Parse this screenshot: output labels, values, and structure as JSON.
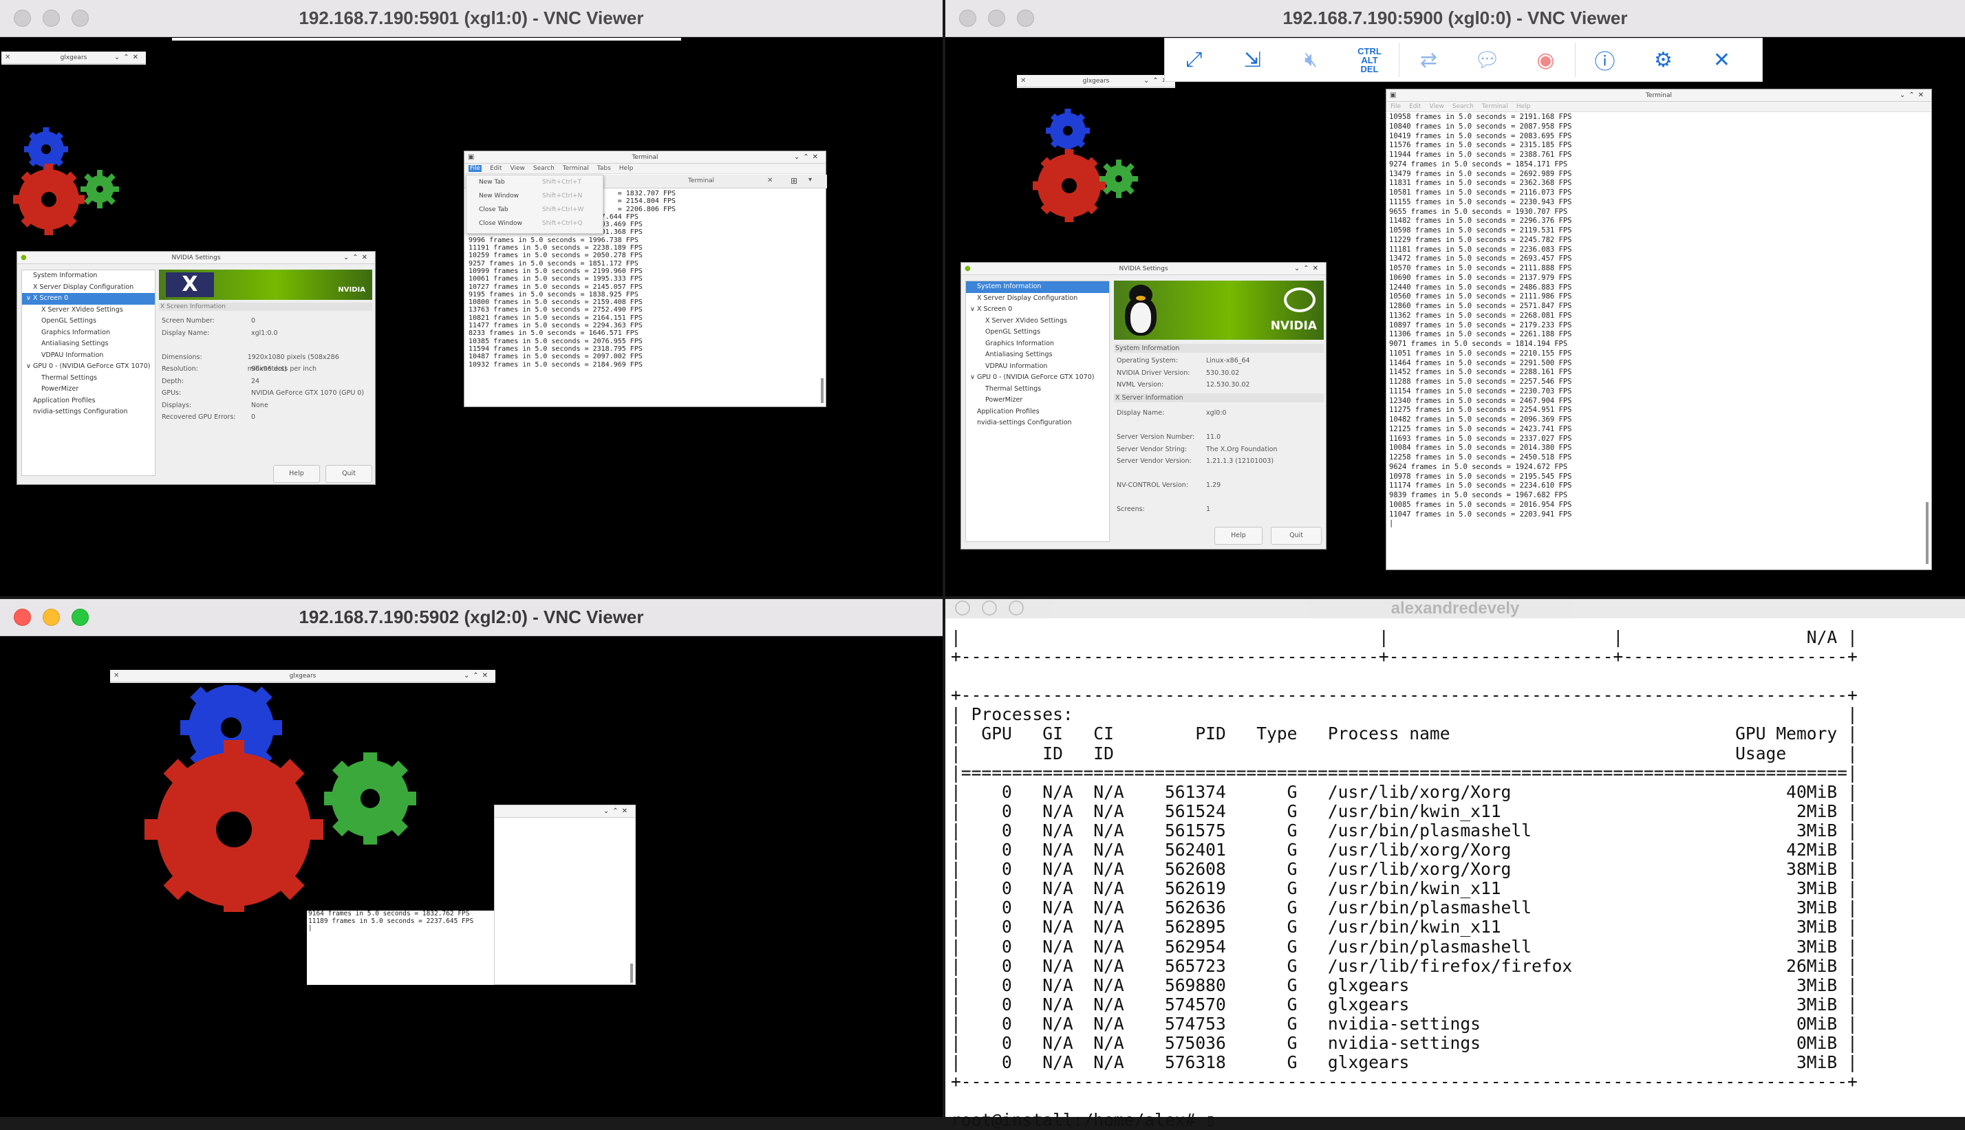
{
  "windows": {
    "tl": {
      "title": "192.168.7.190:5901 (xgl1:0) - VNC Viewer"
    },
    "tr": {
      "title": "192.168.7.190:5900 (xgl0:0) - VNC Viewer"
    },
    "bl": {
      "title": "192.168.7.190:5902 (xgl2:0) - VNC Viewer"
    },
    "br": {
      "title": "alexandredevely"
    }
  },
  "colors": {
    "gear_red": "#c8281c",
    "gear_green": "#3aa83a",
    "gear_blue": "#1f3fd6",
    "nvidia_green": "#76b900",
    "selection": "#3b84d8"
  },
  "toolbar": {
    "icons": [
      "fullscreen-icon",
      "scale-icon",
      "mute-icon",
      "ctrl-alt-del-icon",
      "transfer-icon",
      "chat-icon",
      "record-icon",
      "info-icon",
      "gear-icon",
      "close-icon"
    ],
    "ctrl_alt_del": "CTRL\nALT\nDEL"
  },
  "glxgears": {
    "title": "glxgears"
  },
  "terminal": {
    "title": "Terminal",
    "menu": [
      "File",
      "Edit",
      "View",
      "Search",
      "Terminal",
      "Tabs",
      "Help"
    ],
    "menu_tr": [
      "File",
      "Edit",
      "View",
      "Search",
      "Terminal",
      "Help"
    ],
    "file_menu": [
      "New Tab",
      "New Window",
      "Close Tab",
      "Close Window"
    ],
    "file_menu_keys": [
      "Shift+Ctrl+T",
      "Shift+Ctrl+N",
      "Shift+Ctrl+W",
      "Shift+Ctrl+Q"
    ],
    "tab_label": "Terminal",
    "tl_lines": "                                    = 1832.707 FPS\n                                    = 2154.804 FPS\n                                    = 2206.806 FPS\n9349 frames in 5.0 seconds = 1867.644 FPS\n11023 frames in 5.0 seconds = 2203.469 FPS\n11068 frames in 5.0 seconds = 2201.368 FPS\n9996 frames in 5.0 seconds = 1996.738 FPS\n11191 frames in 5.0 seconds = 2238.189 FPS\n10259 frames in 5.0 seconds = 2050.278 FPS\n9257 frames in 5.0 seconds = 1851.172 FPS\n10999 frames in 5.0 seconds = 2199.960 FPS\n10061 frames in 5.0 seconds = 1995.333 FPS\n10727 frames in 5.0 seconds = 2145.057 FPS\n9195 frames in 5.0 seconds = 1838.925 FPS\n10800 frames in 5.0 seconds = 2159.408 FPS\n13763 frames in 5.0 seconds = 2752.490 FPS\n10821 frames in 5.0 seconds = 2164.151 FPS\n11477 frames in 5.0 seconds = 2294.363 FPS\n8233 frames in 5.0 seconds = 1646.571 FPS\n10385 frames in 5.0 seconds = 2076.955 FPS\n11594 frames in 5.0 seconds = 2318.795 FPS\n10487 frames in 5.0 seconds = 2097.002 FPS\n10932 frames in 5.0 seconds = 2184.969 FPS",
    "tr_lines": "10958 frames in 5.0 seconds = 2191.168 FPS\n10840 frames in 5.0 seconds = 2087.958 FPS\n10419 frames in 5.0 seconds = 2083.695 FPS\n11576 frames in 5.0 seconds = 2315.185 FPS\n11944 frames in 5.0 seconds = 2388.761 FPS\n9274 frames in 5.0 seconds = 1854.171 FPS\n13479 frames in 5.0 seconds = 2692.989 FPS\n11831 frames in 5.0 seconds = 2362.368 FPS\n10581 frames in 5.0 seconds = 2116.073 FPS\n11155 frames in 5.0 seconds = 2230.943 FPS\n9655 frames in 5.0 seconds = 1930.707 FPS\n11482 frames in 5.0 seconds = 2296.376 FPS\n10598 frames in 5.0 seconds = 2119.531 FPS\n11229 frames in 5.0 seconds = 2245.782 FPS\n11181 frames in 5.0 seconds = 2236.083 FPS\n13472 frames in 5.0 seconds = 2693.457 FPS\n10570 frames in 5.0 seconds = 2111.888 FPS\n10690 frames in 5.0 seconds = 2137.979 FPS\n12440 frames in 5.0 seconds = 2486.883 FPS\n10560 frames in 5.0 seconds = 2111.986 FPS\n12860 frames in 5.0 seconds = 2571.847 FPS\n11362 frames in 5.0 seconds = 2268.081 FPS\n10897 frames in 5.0 seconds = 2179.233 FPS\n11306 frames in 5.0 seconds = 2261.188 FPS\n9071 frames in 5.0 seconds = 1814.194 FPS\n11051 frames in 5.0 seconds = 2210.155 FPS\n11464 frames in 5.0 seconds = 2291.500 FPS\n11452 frames in 5.0 seconds = 2288.161 FPS\n11288 frames in 5.0 seconds = 2257.546 FPS\n11154 frames in 5.0 seconds = 2230.703 FPS\n12340 frames in 5.0 seconds = 2467.904 FPS\n11275 frames in 5.0 seconds = 2254.951 FPS\n10482 frames in 5.0 seconds = 2096.369 FPS\n12125 frames in 5.0 seconds = 2423.741 FPS\n11693 frames in 5.0 seconds = 2337.027 FPS\n10084 frames in 5.0 seconds = 2014.380 FPS\n12258 frames in 5.0 seconds = 2450.518 FPS\n9624 frames in 5.0 seconds = 1924.672 FPS\n10978 frames in 5.0 seconds = 2195.545 FPS\n11174 frames in 5.0 seconds = 2234.610 FPS\n9839 frames in 5.0 seconds = 1967.682 FPS\n10085 frames in 5.0 seconds = 2016.954 FPS\n11047 frames in 5.0 seconds = 2203.941 FPS\n|",
    "bl_lines": "9164 frames in 5.0 seconds = 1832.762 FPS\n11189 frames in 5.0 seconds = 2237.645 FPS\n|"
  },
  "nvidia": {
    "title": "NVIDIA Settings",
    "tl_tree": [
      "System Information",
      "X Server Display Configuration",
      "∨ X Screen 0",
      "X Server XVideo Settings",
      "OpenGL Settings",
      "Graphics Information",
      "Antialiasing Settings",
      "VDPAU Information",
      "∨ GPU 0 - (NVIDIA GeForce GTX 1070)",
      "Thermal Settings",
      "PowerMizer",
      "Application Profiles",
      "nvidia-settings Configuration"
    ],
    "tr_tree": [
      "System Information",
      "X Server Display Configuration",
      "∨ X Screen 0",
      "X Server XVideo Settings",
      "OpenGL Settings",
      "Graphics Information",
      "Antialiasing Settings",
      "VDPAU Information",
      "∨ GPU 0 - (NVIDIA GeForce GTX 1070)",
      "Thermal Settings",
      "PowerMizer",
      "Application Profiles",
      "nvidia-settings Configuration"
    ],
    "tl_section": "X Screen Information",
    "tl_info": [
      [
        "Screen Number:",
        "0"
      ],
      [
        "Display Name:",
        "xgl1:0.0"
      ],
      [
        "",
        ""
      ],
      [
        "Dimensions:",
        "1920x1080 pixels (508x286 millimeters)"
      ],
      [
        "Resolution:",
        "96x96 dots per inch"
      ],
      [
        "Depth:",
        "24"
      ],
      [
        "GPUs:",
        "NVIDIA GeForce GTX 1070 (GPU 0)"
      ],
      [
        "Displays:",
        "None"
      ],
      [
        "Recovered GPU Errors:",
        "0"
      ]
    ],
    "tr_section1": "System Information",
    "tr_info1": [
      [
        "Operating System:",
        "Linux-x86_64"
      ],
      [
        "NVIDIA Driver Version:",
        "530.30.02"
      ],
      [
        "NVML Version:",
        "12.530.30.02"
      ]
    ],
    "tr_section2": "X Server Information",
    "tr_info2": [
      [
        "Display Name:",
        "xgl0:0"
      ],
      [
        "",
        ""
      ],
      [
        "Server Version Number:",
        "11.0"
      ],
      [
        "Server Vendor String:",
        "The X.Org Foundation"
      ],
      [
        "Server Vendor Version:",
        "1.21.1.3 (12101003)"
      ],
      [
        "",
        ""
      ],
      [
        "NV-CONTROL Version:",
        "1.29"
      ],
      [
        "",
        ""
      ],
      [
        "Screens:",
        "1"
      ]
    ],
    "help": "Help",
    "quit": "Quit",
    "logo": "NVIDIA"
  },
  "smi": {
    "lines": "|                                         |                      |                  N/A |\n+-----------------------------------------+----------------------+----------------------+\n\n+---------------------------------------------------------------------------------------+\n| Processes:                                                                            |\n|  GPU   GI   CI        PID   Type   Process name                            GPU Memory |\n|        ID   ID                                                             Usage      |\n|=======================================================================================|\n|    0   N/A  N/A    561374      G   /usr/lib/xorg/Xorg                           40MiB |\n|    0   N/A  N/A    561524      G   /usr/bin/kwin_x11                             2MiB |\n|    0   N/A  N/A    561575      G   /usr/bin/plasmashell                          3MiB |\n|    0   N/A  N/A    562401      G   /usr/lib/xorg/Xorg                           42MiB |\n|    0   N/A  N/A    562608      G   /usr/lib/xorg/Xorg                           38MiB |\n|    0   N/A  N/A    562619      G   /usr/bin/kwin_x11                             3MiB |\n|    0   N/A  N/A    562636      G   /usr/bin/plasmashell                          3MiB |\n|    0   N/A  N/A    562895      G   /usr/bin/kwin_x11                             3MiB |\n|    0   N/A  N/A    562954      G   /usr/bin/plasmashell                          3MiB |\n|    0   N/A  N/A    565723      G   /usr/lib/firefox/firefox                     26MiB |\n|    0   N/A  N/A    569880      G   glxgears                                      3MiB |\n|    0   N/A  N/A    574570      G   glxgears                                      3MiB |\n|    0   N/A  N/A    574753      G   nvidia-settings                               0MiB |\n|    0   N/A  N/A    575036      G   nvidia-settings                               0MiB |\n|    0   N/A  N/A    576318      G   glxgears                                      3MiB |\n+---------------------------------------------------------------------------------------+\n\nroot@install:/home/alex# ▯"
  }
}
